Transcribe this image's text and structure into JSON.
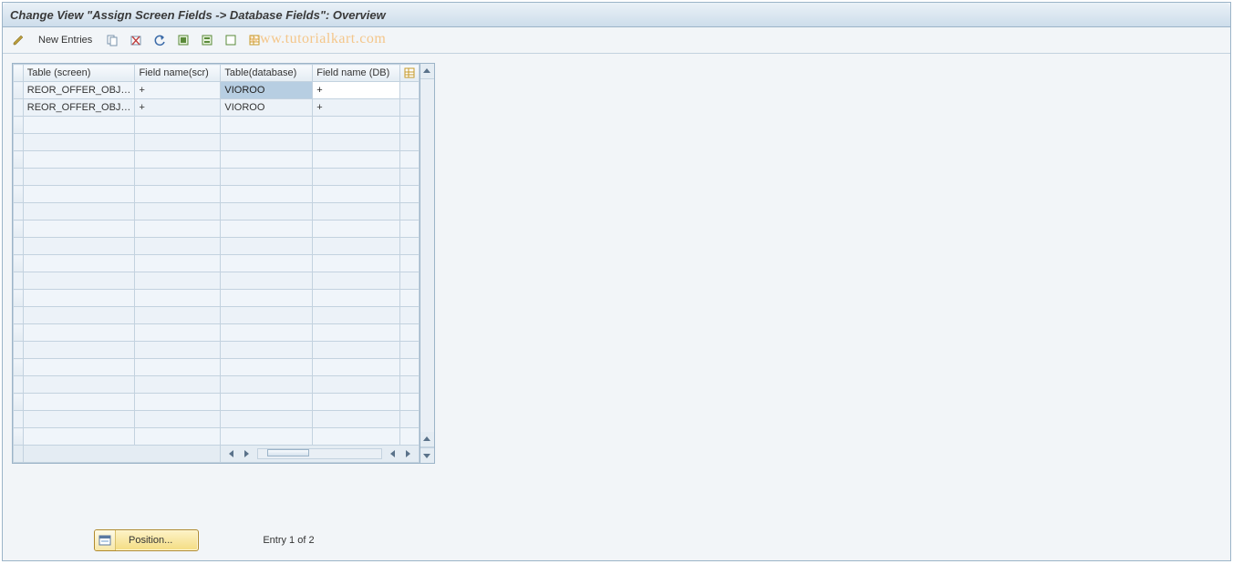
{
  "header": {
    "title": "Change View \"Assign Screen Fields -> Database Fields\": Overview"
  },
  "toolbar": {
    "new_entries": "New Entries"
  },
  "watermark": "www.tutorialkart.com",
  "table": {
    "columns": {
      "screen_table": "Table (screen)",
      "screen_field": "Field name(scr)",
      "db_table": "Table(database)",
      "db_field": "Field name (DB)"
    },
    "rows": [
      {
        "screen_table": "REOR_OFFER_OBJ…",
        "screen_field": "+",
        "db_table": "VIOROO",
        "db_field": "+"
      },
      {
        "screen_table": "REOR_OFFER_OBJ…",
        "screen_field": "+",
        "db_table": "VIOROO",
        "db_field": "+"
      }
    ]
  },
  "footer": {
    "position_label": "Position...",
    "entry_text": "Entry 1 of 2"
  }
}
